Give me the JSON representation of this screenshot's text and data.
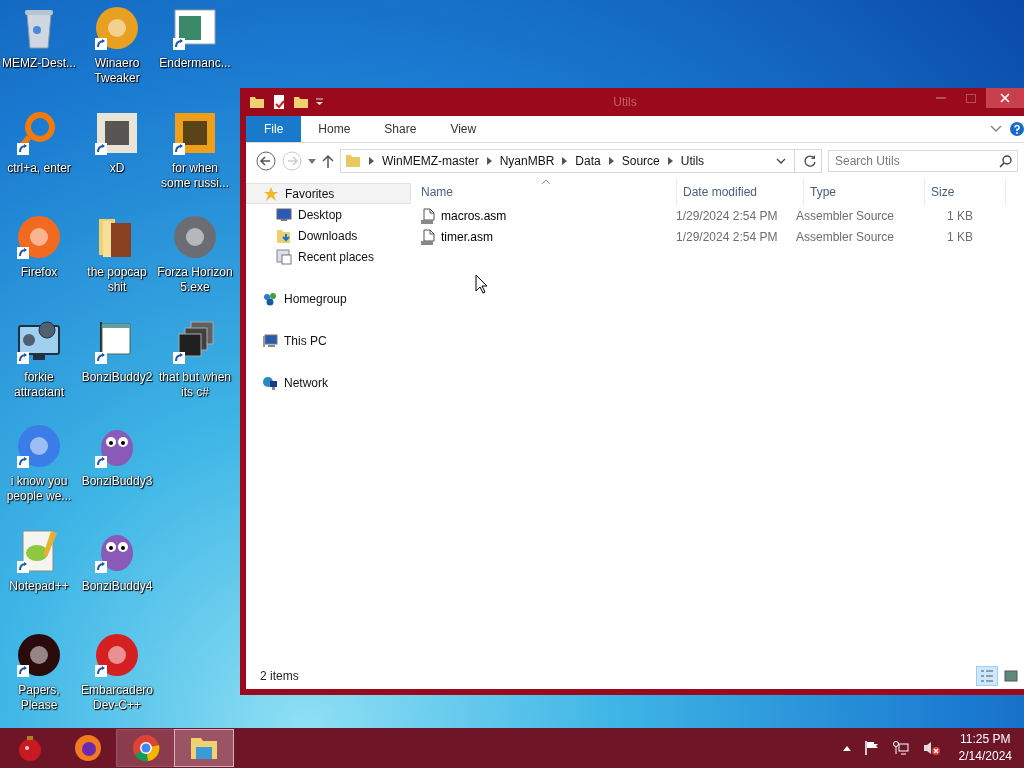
{
  "desktop": {
    "icons": [
      {
        "label": "MEMZ-Dest...",
        "kind": "bin",
        "shortcut": false
      },
      {
        "label": "ctrl+a, enter",
        "kind": "ring",
        "color": "#f07a10",
        "shortcut": true
      },
      {
        "label": "Firefox",
        "kind": "circle",
        "color": "#f26a1f",
        "shortcut": true
      },
      {
        "label": "forkie attractant",
        "kind": "monitor",
        "shortcut": true
      },
      {
        "label": "i know you people we...",
        "kind": "circle",
        "color": "#3b7de8",
        "shortcut": true
      },
      {
        "label": "Notepad++",
        "kind": "notepad",
        "shortcut": true
      },
      {
        "label": "Papers, Please",
        "kind": "circle",
        "color": "#2a0a0a",
        "shortcut": true
      },
      {
        "label": "Winaero Tweaker",
        "kind": "circle",
        "color": "#e8a020",
        "shortcut": true
      },
      {
        "label": "xD",
        "kind": "tile",
        "color": "#e9e4d8",
        "shortcut": true
      },
      {
        "label": "the popcap shit",
        "kind": "folder",
        "shortcut": false
      },
      {
        "label": "BonziBuddy2",
        "kind": "flag",
        "shortcut": true
      },
      {
        "label": "BonziBuddy3",
        "kind": "creature",
        "shortcut": true
      },
      {
        "label": "BonziBuddy4",
        "kind": "creature",
        "shortcut": true
      },
      {
        "label": "Embarcadero Dev-C++",
        "kind": "circle",
        "color": "#d42020",
        "shortcut": true
      },
      {
        "label": "Endermanc...",
        "kind": "window",
        "shortcut": true
      },
      {
        "label": "for when some russi...",
        "kind": "tile",
        "color": "#f0a018",
        "shortcut": true
      },
      {
        "label": "Forza Horizon 5.exe",
        "kind": "circle",
        "color": "#6a6e74",
        "shortcut": false
      },
      {
        "label": "that but when its c#",
        "kind": "stack",
        "shortcut": true
      }
    ]
  },
  "window": {
    "title": "Utils",
    "ribbon_tabs": [
      {
        "label": "File",
        "kind": "file"
      },
      {
        "label": "Home",
        "kind": "tab"
      },
      {
        "label": "Share",
        "kind": "tab"
      },
      {
        "label": "View",
        "kind": "tab"
      }
    ],
    "address": [
      "WinMEMZ-master",
      "NyanMBR",
      "Data",
      "Source",
      "Utils"
    ],
    "search": {
      "placeholder": "Search Utils"
    },
    "nav": [
      {
        "label": "Favorites",
        "kind": "star",
        "selected": true,
        "children": [
          {
            "label": "Desktop",
            "kind": "desktop",
            "selected": false
          },
          {
            "label": "Downloads",
            "kind": "downloads",
            "selected": false
          },
          {
            "label": "Recent places",
            "kind": "recent",
            "selected": false
          }
        ]
      },
      {
        "label": "Homegroup",
        "kind": "homegroup",
        "selected": false
      },
      {
        "label": "This PC",
        "kind": "pc",
        "selected": false
      },
      {
        "label": "Network",
        "kind": "network",
        "selected": false
      }
    ],
    "columns": [
      {
        "label": "Name",
        "sorted": true
      },
      {
        "label": "Date modified",
        "sorted": false
      },
      {
        "label": "Type",
        "sorted": false
      },
      {
        "label": "Size",
        "sorted": false
      }
    ],
    "files": [
      {
        "name": "macros.asm",
        "date": "1/29/2024 2:54 PM",
        "type": "Assembler Source",
        "size": "1 KB"
      },
      {
        "name": "timer.asm",
        "date": "1/29/2024 2:54 PM",
        "type": "Assembler Source",
        "size": "1 KB"
      }
    ],
    "status": "2 items",
    "views": [
      {
        "kind": "details",
        "selected": true
      },
      {
        "kind": "thumbnails",
        "selected": false
      }
    ]
  },
  "taskbar": {
    "items": [
      {
        "kind": "ornament",
        "running": false,
        "selected": false
      },
      {
        "kind": "firefox",
        "running": false,
        "selected": false
      },
      {
        "kind": "chrome",
        "running": true,
        "selected": false
      },
      {
        "kind": "explorer",
        "running": true,
        "selected": true
      }
    ],
    "speaker_muted": true,
    "time": "11:25 PM",
    "date": "2/14/2024"
  }
}
